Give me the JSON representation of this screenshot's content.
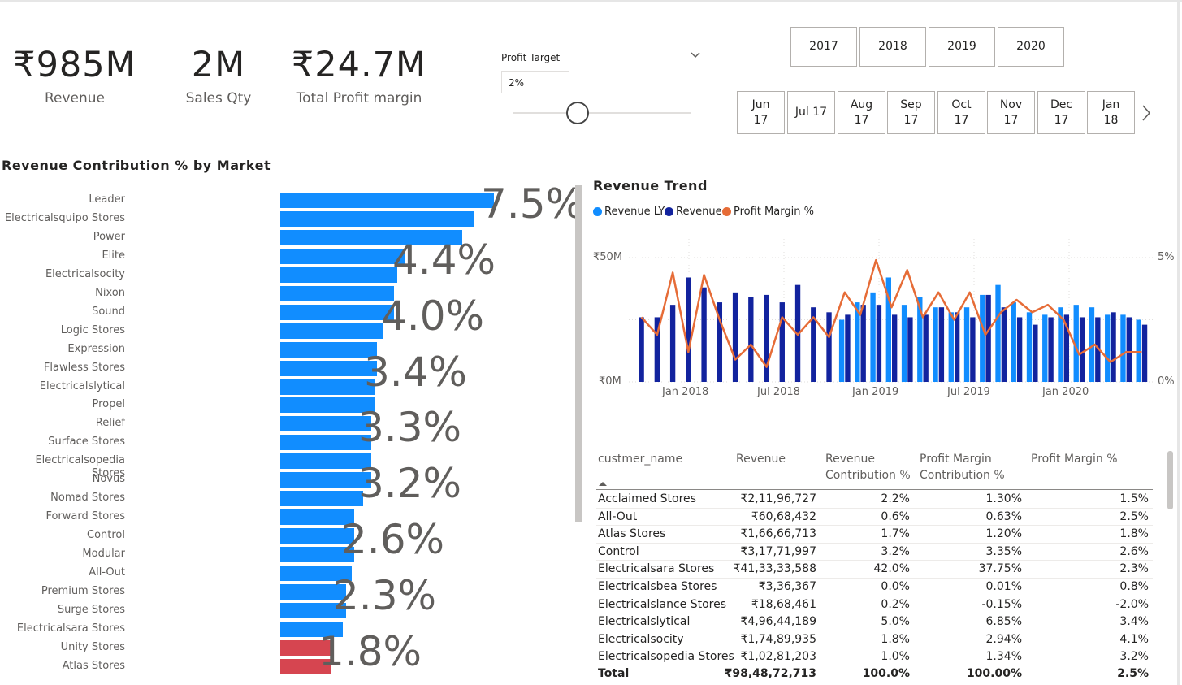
{
  "kpis": [
    {
      "value": "₹985M",
      "label": "Revenue"
    },
    {
      "value": "2M",
      "label": "Sales Qty"
    },
    {
      "value": "₹24.7M",
      "label": "Total Profit margin"
    }
  ],
  "profit_target": {
    "title": "Profit Target",
    "value": "2%",
    "slider_level": 0.35
  },
  "years": [
    "2017",
    "2018",
    "2019",
    "2020"
  ],
  "months": [
    {
      "line1": "Jun",
      "line2": "17"
    },
    {
      "line1": "Jul 17",
      "line2": ""
    },
    {
      "line1": "Aug",
      "line2": "17"
    },
    {
      "line1": "Sep",
      "line2": "17"
    },
    {
      "line1": "Oct",
      "line2": "17"
    },
    {
      "line1": "Nov",
      "line2": "17"
    },
    {
      "line1": "Dec",
      "line2": "17"
    },
    {
      "line1": "Jan",
      "line2": "18"
    }
  ],
  "market_chart": {
    "title": "Revenue Contribution % by Market",
    "colors": {
      "above": "#118dff",
      "below": "#d64550"
    },
    "chart_data": {
      "type": "bar",
      "orientation": "horizontal",
      "categories": [
        "Leader",
        "Electricalsquipo Stores",
        "Power",
        "Elite",
        "Electricalsocity",
        "Nixon",
        "Sound",
        "Logic Stores",
        "Expression",
        "Flawless Stores",
        "Electricalslytical",
        "Propel",
        "Relief",
        "Surface Stores",
        "Electricalsopedia Stores",
        "Novus",
        "Nomad Stores",
        "Forward Stores",
        "Control",
        "Modular",
        "All-Out",
        "Premium Stores",
        "Surge Stores",
        "Electricalsara Stores",
        "Unity Stores",
        "Atlas Stores"
      ],
      "values": [
        7.5,
        6.8,
        6.4,
        4.4,
        4.1,
        4.0,
        4.0,
        3.6,
        3.4,
        3.4,
        3.3,
        3.3,
        3.2,
        3.2,
        3.2,
        3.2,
        2.9,
        2.6,
        2.6,
        2.6,
        2.5,
        2.3,
        2.3,
        2.2,
        1.8,
        1.8
      ],
      "bar_status": [
        "above",
        "above",
        "above",
        "above",
        "above",
        "above",
        "above",
        "above",
        "above",
        "above",
        "above",
        "above",
        "above",
        "above",
        "above",
        "above",
        "above",
        "above",
        "above",
        "above",
        "above",
        "above",
        "above",
        "above",
        "below",
        "below"
      ],
      "data_labels": [
        "7.5%",
        "4.4%",
        "4.0%",
        "3.4%",
        "3.3%",
        "3.2%",
        "2.6%",
        "2.3%",
        "1.8%"
      ],
      "data_label_rows": [
        0,
        3,
        6,
        9,
        12,
        15,
        18,
        21,
        24
      ]
    }
  },
  "trend_chart": {
    "title": "Revenue Trend",
    "legend": [
      {
        "name": "Revenue LY",
        "color": "#118dff"
      },
      {
        "name": "Revenue",
        "color": "#12239e"
      },
      {
        "name": "Profit Margin %",
        "color": "#e66c37"
      }
    ],
    "y_left_labels": [
      "₹50M",
      "₹0M"
    ],
    "y_right_labels": [
      "5%",
      "0%"
    ],
    "x_labels": [
      "Jan 2018",
      "Jul 2018",
      "Jan 2019",
      "Jul 2019",
      "Jan 2020"
    ],
    "chart_data": {
      "type": "bar+line",
      "x": [
        "2017-10",
        "2017-11",
        "2017-12",
        "2018-01",
        "2018-02",
        "2018-03",
        "2018-04",
        "2018-05",
        "2018-06",
        "2018-07",
        "2018-08",
        "2018-09",
        "2018-10",
        "2018-11",
        "2018-12",
        "2019-01",
        "2019-02",
        "2019-03",
        "2019-04",
        "2019-05",
        "2019-06",
        "2019-07",
        "2019-08",
        "2019-09",
        "2019-10",
        "2019-11",
        "2019-12",
        "2020-01",
        "2020-02",
        "2020-03",
        "2020-04",
        "2020-05",
        "2020-06"
      ],
      "series": [
        {
          "name": "Revenue LY",
          "axis": "left",
          "values": [
            null,
            null,
            null,
            null,
            null,
            null,
            null,
            null,
            null,
            null,
            null,
            null,
            null,
            25,
            32,
            36,
            42,
            31,
            34,
            30,
            28,
            30,
            35,
            39,
            32,
            28,
            27,
            30,
            31,
            30,
            27,
            27,
            25
          ]
        },
        {
          "name": "Revenue",
          "axis": "left",
          "values": [
            26,
            26,
            31,
            42,
            38,
            32,
            36,
            34,
            35,
            32,
            39,
            30,
            28,
            27,
            31,
            31,
            27,
            26,
            27,
            30,
            28,
            26,
            35,
            30,
            26,
            23,
            26,
            27,
            26,
            26,
            28,
            26,
            23
          ]
        },
        {
          "name": "Profit Margin %",
          "axis": "right",
          "values": [
            2.6,
            1.9,
            4.4,
            1.2,
            4.3,
            2.5,
            0.9,
            1.5,
            0.6,
            2.6,
            1.9,
            2.6,
            1.8,
            3.6,
            2.7,
            4.9,
            3.0,
            4.5,
            2.6,
            3.6,
            2.5,
            3.6,
            1.9,
            2.8,
            3.3,
            2.8,
            3.1,
            2.5,
            1.1,
            1.5,
            0.8,
            1.2,
            1.2
          ]
        }
      ],
      "ylim_left": [
        0,
        50
      ],
      "ylim_right": [
        0,
        5
      ]
    }
  },
  "table": {
    "headers": [
      {
        "line1": "custmer_name",
        "line2": ""
      },
      {
        "line1": "Revenue",
        "line2": ""
      },
      {
        "line1": "Revenue",
        "line2": "Contribution %"
      },
      {
        "line1": "Profit Margin",
        "line2": "Contribution %"
      },
      {
        "line1": "Profit Margin %",
        "line2": ""
      }
    ],
    "rows": [
      [
        "Acclaimed Stores",
        "₹2,11,96,727",
        "2.2%",
        "1.30%",
        "1.5%"
      ],
      [
        "All-Out",
        "₹60,68,432",
        "0.6%",
        "0.63%",
        "2.5%"
      ],
      [
        "Atlas Stores",
        "₹1,66,66,713",
        "1.7%",
        "1.20%",
        "1.8%"
      ],
      [
        "Control",
        "₹3,17,71,997",
        "3.2%",
        "3.35%",
        "2.6%"
      ],
      [
        "Electricalsara Stores",
        "₹41,33,33,588",
        "42.0%",
        "37.75%",
        "2.3%"
      ],
      [
        "Electricalsbea Stores",
        "₹3,36,367",
        "0.0%",
        "0.01%",
        "0.8%"
      ],
      [
        "Electricalslance Stores",
        "₹18,68,461",
        "0.2%",
        "-0.15%",
        "-2.0%"
      ],
      [
        "Electricalslytical",
        "₹4,96,44,189",
        "5.0%",
        "6.85%",
        "3.4%"
      ],
      [
        "Electricalsocity",
        "₹1,74,89,935",
        "1.8%",
        "2.94%",
        "4.1%"
      ],
      [
        "Electricalsopedia Stores",
        "₹1,02,81,203",
        "1.0%",
        "1.34%",
        "3.2%"
      ]
    ],
    "total": [
      "Total",
      "₹98,48,72,713",
      "100.0%",
      "100.00%",
      "2.5%"
    ]
  }
}
